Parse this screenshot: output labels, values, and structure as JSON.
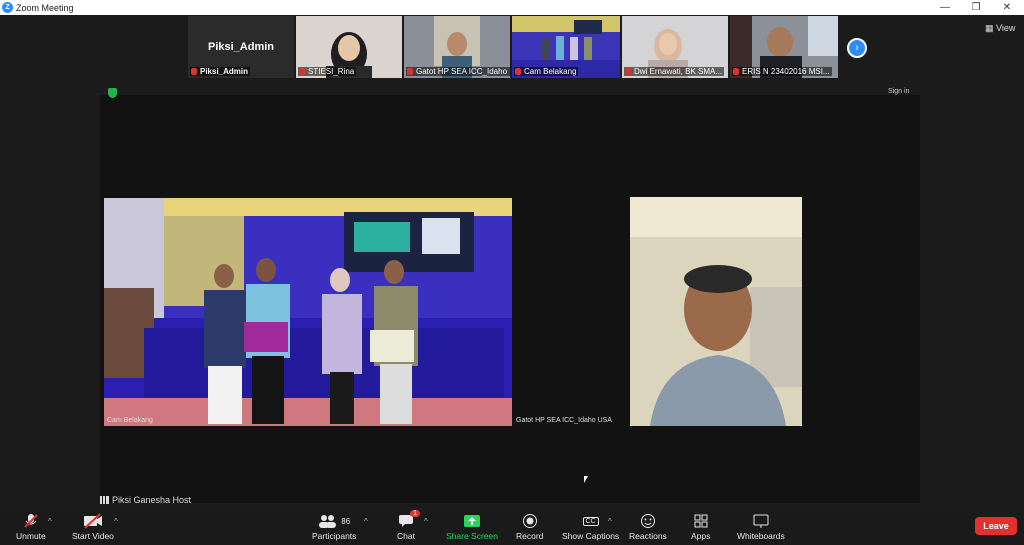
{
  "window": {
    "title": "Zoom Meeting",
    "logo_letter": "Z",
    "minimize": "—",
    "restore": "❐",
    "close": "✕"
  },
  "top_strip": {
    "tiles": [
      {
        "display_name": "Piksi_Admin",
        "label": "Piksi_Admin"
      },
      {
        "label": "STIESI_Rina"
      },
      {
        "label": "Gatot HP SEA ICC_Idaho ..."
      },
      {
        "label": "Cam Belakang"
      },
      {
        "label": "Dwi Ernawati, BK SMA..."
      },
      {
        "label": "ERIS N 23402016 MSI..."
      }
    ],
    "next_symbol": "›"
  },
  "view_button": "View",
  "sign_in": "Sign in",
  "videos": {
    "main_label": "Cam Belakang",
    "right_label": "Gatot HP SEA ICC_Idaho USA"
  },
  "host_bar": "Piksi Ganesha Host",
  "toolbar": {
    "unmute": "Unmute",
    "start_video": "Start Video",
    "participants": "Participants",
    "participants_count": "86",
    "chat": "Chat",
    "chat_badge": "1",
    "share_screen": "Share Screen",
    "record": "Record",
    "captions": "Show Captions",
    "captions_icon": "CC",
    "reactions": "Reactions",
    "apps": "Apps",
    "whiteboards": "Whiteboards",
    "caret": "^",
    "leave": "Leave"
  },
  "colors": {
    "zoom_blue": "#2d8cff",
    "leave_red": "#e0312f",
    "share_green": "#23d959",
    "security_green": "#22b14c"
  }
}
